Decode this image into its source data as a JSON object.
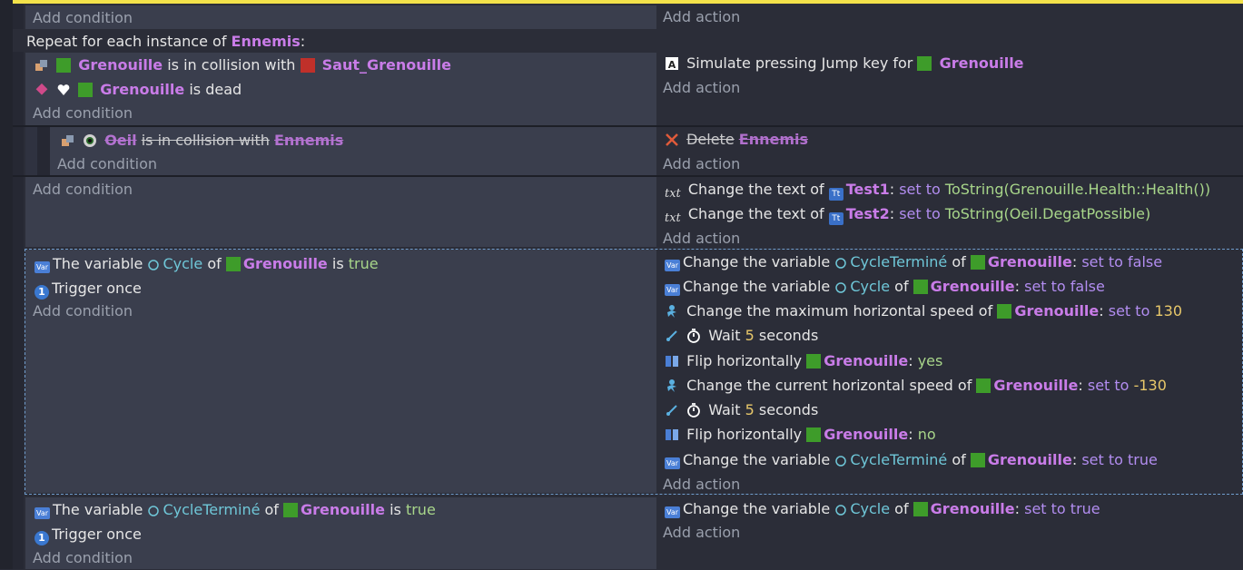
{
  "labels": {
    "add_condition": "Add condition",
    "add_action": "Add action"
  },
  "repeat": {
    "text": "Repeat for each instance of",
    "object": "Ennemis",
    "colon": ":"
  },
  "block1": {
    "c1": {
      "obj": "Grenouille",
      "mid": "is in collision with",
      "obj2": "Saut_Grenouille"
    },
    "c2": {
      "obj": "Grenouille",
      "mid": "is dead"
    },
    "a1": {
      "text": "Simulate pressing Jump key for",
      "obj": "Grenouille"
    }
  },
  "block2": {
    "c1": {
      "obj": "Oeil",
      "mid": "is in collision with",
      "obj2": "Ennemis"
    },
    "a1": {
      "text": "Delete",
      "obj": "Ennemis"
    }
  },
  "block3": {
    "a1": {
      "pre": "Change the text of",
      "obj": "Test1",
      "colon": ":",
      "op": "set to",
      "expr": "ToString(Grenouille.Health::Health())"
    },
    "a2": {
      "pre": "Change the text of",
      "obj": "Test2",
      "colon": ":",
      "op": "set to",
      "expr": "ToString(Oeil.DegatPossible)"
    }
  },
  "block4": {
    "c1": {
      "pre": "The variable",
      "var": "Cycle",
      "of": "of",
      "obj": "Grenouille",
      "is": "is",
      "val": "true"
    },
    "c2": {
      "text": "Trigger once"
    },
    "actions": [
      {
        "pre": "Change the variable",
        "var": "CycleTerminé",
        "of": "of",
        "obj": "Grenouille",
        "colon": ":",
        "op": "set to false"
      },
      {
        "pre": "Change the variable",
        "var": "Cycle",
        "of": "of",
        "obj": "Grenouille",
        "colon": ":",
        "op": "set to false"
      },
      {
        "pre": "Change the maximum horizontal speed of",
        "obj": "Grenouille",
        "colon": ":",
        "op": "set to",
        "num": "130"
      },
      {
        "pre": "Wait",
        "num": "5",
        "post": "seconds"
      },
      {
        "pre": "Flip horizontally",
        "obj": "Grenouille",
        "colon": ":",
        "val": "yes"
      },
      {
        "pre": "Change the current horizontal speed of",
        "obj": "Grenouille",
        "colon": ":",
        "op": "set to",
        "num": "-130"
      },
      {
        "pre": "Wait",
        "num": "5",
        "post": "seconds"
      },
      {
        "pre": "Flip horizontally",
        "obj": "Grenouille",
        "colon": ":",
        "val": "no"
      },
      {
        "pre": "Change the variable",
        "var": "CycleTerminé",
        "of": "of",
        "obj": "Grenouille",
        "colon": ":",
        "op": "set to true"
      }
    ]
  },
  "block5": {
    "c1": {
      "pre": "The variable",
      "var": "CycleTerminé",
      "of": "of",
      "obj": "Grenouille",
      "is": "is",
      "val": "true"
    },
    "c2": {
      "text": "Trigger once"
    },
    "a1": {
      "pre": "Change the variable",
      "var": "Cycle",
      "of": "of",
      "obj": "Grenouille",
      "colon": ":",
      "op": "set to true"
    }
  },
  "colors": {
    "accent": "#f3e24a",
    "object": "#c97ce8",
    "variable": "#6fc7d8",
    "value": "#a8d68a",
    "number": "#e8c86a"
  }
}
